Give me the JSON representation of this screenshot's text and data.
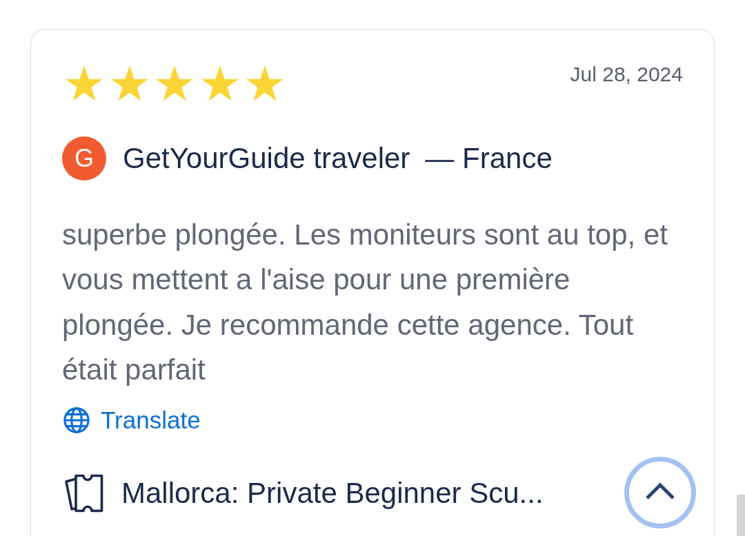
{
  "review": {
    "stars": 5,
    "date": "Jul 28, 2024",
    "avatar_initial": "G",
    "author": "GetYourGuide traveler",
    "origin": "— France",
    "text": "superbe plongée. Les moniteurs sont au top, et vous mettent a l'aise pour une première plongée. Je recommande cette agence. Tout était parfait",
    "translate_link": "Translate",
    "activity": "Mallorca: Private Beginner Scu..."
  }
}
